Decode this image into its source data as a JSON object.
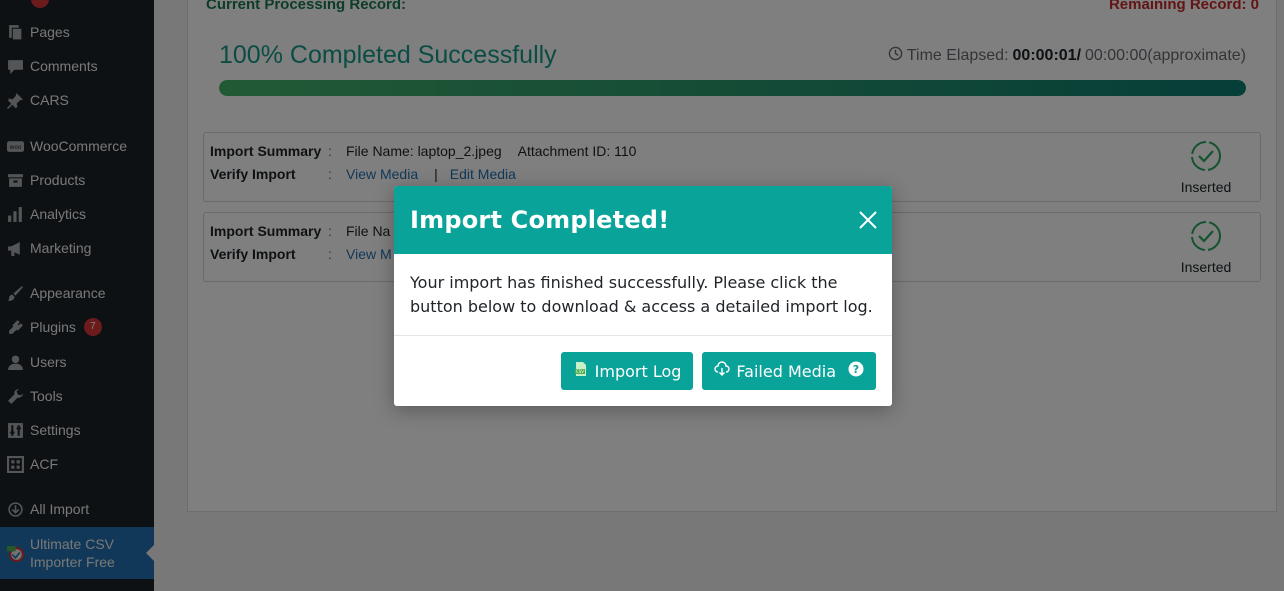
{
  "sidebar": {
    "items": [
      {
        "label": "Pages",
        "icon": "pages-icon"
      },
      {
        "label": "Comments",
        "icon": "comments-icon"
      },
      {
        "label": "CARS",
        "icon": "pin-icon"
      },
      {
        "label": "WooCommerce",
        "icon": "woocommerce-icon"
      },
      {
        "label": "Products",
        "icon": "products-icon"
      },
      {
        "label": "Analytics",
        "icon": "analytics-icon"
      },
      {
        "label": "Marketing",
        "icon": "megaphone-icon"
      },
      {
        "label": "Appearance",
        "icon": "brush-icon"
      },
      {
        "label": "Plugins",
        "icon": "plugin-icon",
        "badge": "7"
      },
      {
        "label": "Users",
        "icon": "users-icon"
      },
      {
        "label": "Tools",
        "icon": "wrench-icon"
      },
      {
        "label": "Settings",
        "icon": "settings-icon"
      },
      {
        "label": "ACF",
        "icon": "acf-icon"
      },
      {
        "label": "All Import",
        "icon": "all-import-icon"
      },
      {
        "label": "Ultimate CSV Importer Free",
        "label_line1": "Ultimate CSV",
        "label_line2": "Importer Free",
        "icon": "csv-importer-icon",
        "active": true
      }
    ]
  },
  "import": {
    "processing_label": "Current Processing Record:",
    "remaining_label": "Remaining Record: 0",
    "completed_text": "100% Completed Successfully",
    "progress_percent": 100,
    "elapsed_label": "Time Elapsed:",
    "elapsed_value": "00:00:01/",
    "elapsed_approx": "00:00:00(approximate)"
  },
  "records": [
    {
      "summary_label": "Import Summary",
      "verify_label": "Verify Import",
      "separator": ":",
      "file_name": "File Name: laptop_2.jpeg",
      "attachment_id": "Attachment ID: 110",
      "view_link": "View Media",
      "edit_link": "Edit Media",
      "status": "Inserted"
    },
    {
      "summary_label": "Import Summary",
      "verify_label": "Verify Import",
      "separator": ":",
      "file_name": "File Na",
      "view_link": "View M",
      "status": "Inserted"
    }
  ],
  "modal": {
    "title": "Import Completed!",
    "body": "Your import has finished successfully. Please click the button below to download & access a detailed import log.",
    "import_log_label": "Import Log",
    "failed_media_label": "Failed Media"
  },
  "colors": {
    "accent": "#0aa39a",
    "sidebar_bg": "#1d2327",
    "active_menu": "#2271b1"
  }
}
